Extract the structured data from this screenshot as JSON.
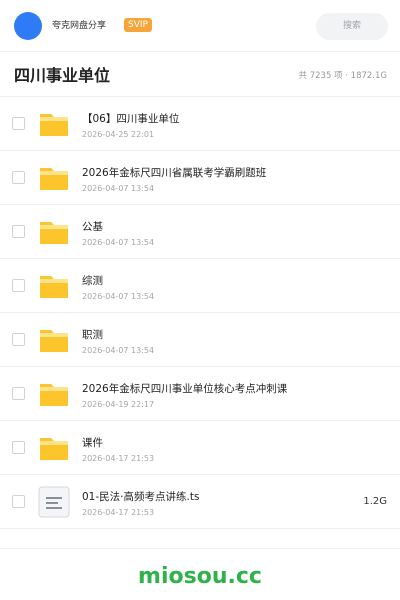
{
  "header": {
    "app_name": "夸克网盘分享",
    "badge": "SVIP",
    "search_placeholder": "搜索"
  },
  "folder": {
    "title": "四川事业单位",
    "summary": "共 7235 项 · 1872.1G"
  },
  "items": [
    {
      "type": "folder",
      "name": "【06】四川事业单位",
      "date": "2026-04-25 22:01",
      "size": ""
    },
    {
      "type": "folder",
      "name": "2026年金标尺四川省属联考学霸刷题班",
      "date": "2026-04-07 13:54",
      "size": ""
    },
    {
      "type": "folder",
      "name": "公基",
      "date": "2026-04-07 13:54",
      "size": ""
    },
    {
      "type": "folder",
      "name": "综测",
      "date": "2026-04-07 13:54",
      "size": ""
    },
    {
      "type": "folder",
      "name": "职测",
      "date": "2026-04-07 13:54",
      "size": ""
    },
    {
      "type": "folder",
      "name": "2026年金标尺四川事业单位核心考点冲刺课",
      "date": "2026-04-19 22:17",
      "size": ""
    },
    {
      "type": "folder",
      "name": "课件",
      "date": "2026-04-17 21:53",
      "size": ""
    },
    {
      "type": "file",
      "name": "01-民法·高频考点讲练.ts",
      "date": "2026-04-17 21:53",
      "size": "1.2G"
    }
  ],
  "watermark": "miosou.cc",
  "colors": {
    "avatar": "#2f7bf5",
    "svip_badge": "#f7a53b",
    "folder_icon": "#fcc52c",
    "watermark": "#2fb24a"
  },
  "icons": {
    "folder": "folder-icon",
    "file": "document-icon"
  }
}
